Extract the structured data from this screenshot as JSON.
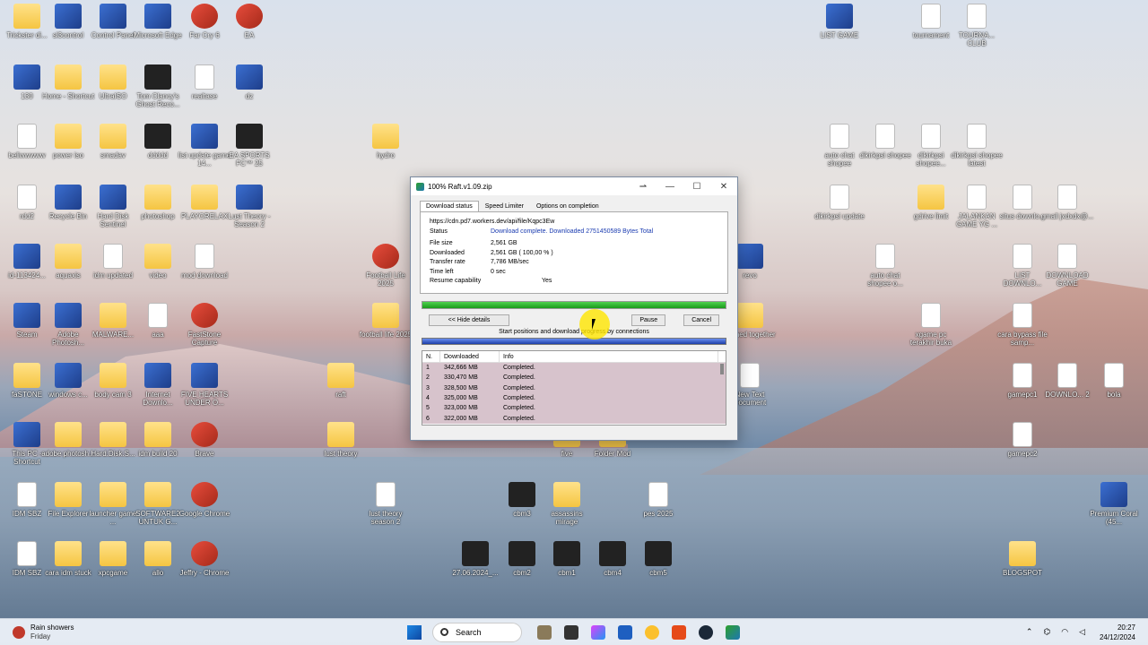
{
  "dialog": {
    "title": "100% Raft.v1.09.zip",
    "tabs": [
      "Download status",
      "Speed Limiter",
      "Options on completion"
    ],
    "url": "https://cdn.pd7.workers.dev/api/file/Kqpc3Ew",
    "status_label": "Status",
    "status_value": "Download complete. Downloaded 2751450589 Bytes Total",
    "file_size_label": "File size",
    "file_size": "2,561 GB",
    "downloaded_label": "Downloaded",
    "downloaded": "2,561 GB ( 100,00 % )",
    "transfer_rate_label": "Transfer rate",
    "transfer_rate": "7,786 MB/sec",
    "time_left_label": "Time left",
    "time_left": "0 sec",
    "resume_label": "Resume capability",
    "resume": "Yes",
    "progress": 1.0,
    "hide_details": "<< Hide details",
    "pause": "Pause",
    "cancel": "Cancel",
    "connections_caption": "Start positions and download progress by connections",
    "table_headers": [
      "N.",
      "Downloaded",
      "Info"
    ],
    "rows": [
      [
        "1",
        "342,666 MB",
        "Completed."
      ],
      [
        "2",
        "330,470 MB",
        "Completed."
      ],
      [
        "3",
        "328,500 MB",
        "Completed."
      ],
      [
        "4",
        "325,000 MB",
        "Completed."
      ],
      [
        "5",
        "323,000 MB",
        "Completed."
      ],
      [
        "6",
        "322,000 MB",
        "Completed."
      ]
    ]
  },
  "desktop_icons": [
    {
      "label": "Trickster di...",
      "kind": "folder"
    },
    {
      "label": "sl3control",
      "kind": "app"
    },
    {
      "label": "Control Panel",
      "kind": "app"
    },
    {
      "label": "Microsoft Edge",
      "kind": "app"
    },
    {
      "label": "Far Cry 6",
      "kind": "red"
    },
    {
      "label": "EA",
      "kind": "red"
    },
    {
      "label": "130",
      "kind": "app"
    },
    {
      "label": "Home - Shortcut",
      "kind": "folder"
    },
    {
      "label": "UltraISO",
      "kind": "folder"
    },
    {
      "label": "Tom Clancy's Ghost Reco...",
      "kind": "dark"
    },
    {
      "label": "realtase",
      "kind": "file"
    },
    {
      "label": "dz",
      "kind": "app"
    },
    {
      "label": "beliwwwww",
      "kind": "file"
    },
    {
      "label": "power iso",
      "kind": "folder"
    },
    {
      "label": "smadav",
      "kind": "folder"
    },
    {
      "label": "ddddd",
      "kind": "dark"
    },
    {
      "label": "list update game 14...",
      "kind": "app"
    },
    {
      "label": "EA SPORTS FC™ 25",
      "kind": "dark"
    },
    {
      "label": "hydro",
      "kind": "folder"
    },
    {
      "label": "rdd2",
      "kind": "file"
    },
    {
      "label": "Recycle Bin",
      "kind": "app"
    },
    {
      "label": "Hard Disk Sentinel",
      "kind": "app"
    },
    {
      "label": "photoshop",
      "kind": "folder"
    },
    {
      "label": "PLAYORELAX",
      "kind": "folder"
    },
    {
      "label": "Lust Theory - Season 2",
      "kind": "app"
    },
    {
      "label": "Football Life 2025",
      "kind": "red"
    },
    {
      "label": "id-113424...",
      "kind": "app"
    },
    {
      "label": "aquaxis",
      "kind": "folder"
    },
    {
      "label": "idm updated",
      "kind": "file"
    },
    {
      "label": "video",
      "kind": "folder"
    },
    {
      "label": "mod download",
      "kind": "file"
    },
    {
      "label": "Steam",
      "kind": "app"
    },
    {
      "label": "Adobe Photosh...",
      "kind": "app"
    },
    {
      "label": "MALWARE...",
      "kind": "folder"
    },
    {
      "label": "aaa",
      "kind": "file"
    },
    {
      "label": "FastStone Capture",
      "kind": "red"
    },
    {
      "label": "football life 2025",
      "kind": "folder"
    },
    {
      "label": "faSTONE",
      "kind": "folder"
    },
    {
      "label": "windows c...",
      "kind": "app"
    },
    {
      "label": "body cam 3",
      "kind": "folder"
    },
    {
      "label": "Internet Downlo...",
      "kind": "app"
    },
    {
      "label": "FIVE HEARTS UNDER O...",
      "kind": "app"
    },
    {
      "label": "raft",
      "kind": "folder"
    },
    {
      "label": "This PC - Shortcut",
      "kind": "app"
    },
    {
      "label": "adobe photosh...",
      "kind": "folder"
    },
    {
      "label": "Hard.Disk.S...",
      "kind": "folder"
    },
    {
      "label": "idm build 20",
      "kind": "folder"
    },
    {
      "label": "Brave",
      "kind": "red"
    },
    {
      "label": "lust theory",
      "kind": "folder"
    },
    {
      "label": "five",
      "kind": "folder"
    },
    {
      "label": "Folder Mod",
      "kind": "folder"
    },
    {
      "label": "IDM SBZ",
      "kind": "file"
    },
    {
      "label": "File Explorer",
      "kind": "folder"
    },
    {
      "label": "launcher game ...",
      "kind": "folder"
    },
    {
      "label": "SOFTWARE2 UNTUK G...",
      "kind": "folder"
    },
    {
      "label": "Google Chrome",
      "kind": "red"
    },
    {
      "label": "lust theory season 2",
      "kind": "file"
    },
    {
      "label": "cbm3",
      "kind": "dark"
    },
    {
      "label": "assassins mirage",
      "kind": "folder"
    },
    {
      "label": "pes 2025",
      "kind": "file"
    },
    {
      "label": "IDM SBZ",
      "kind": "file"
    },
    {
      "label": "cara idm stuck",
      "kind": "folder"
    },
    {
      "label": "xpcgame",
      "kind": "folder"
    },
    {
      "label": "allo",
      "kind": "folder"
    },
    {
      "label": "Jeffry - Chrome",
      "kind": "red"
    },
    {
      "label": "27.06.2024_...",
      "kind": "dark"
    },
    {
      "label": "cbm2",
      "kind": "dark"
    },
    {
      "label": "cbm1",
      "kind": "dark"
    },
    {
      "label": "cbm4",
      "kind": "dark"
    },
    {
      "label": "cbm5",
      "kind": "dark"
    },
    {
      "label": "LIST GAME",
      "kind": "app"
    },
    {
      "label": "tournament",
      "kind": "file"
    },
    {
      "label": "TOURNA... CLUB",
      "kind": "file"
    },
    {
      "label": "auto chat shopee",
      "kind": "file"
    },
    {
      "label": "dikirkpsi shopee",
      "kind": "file"
    },
    {
      "label": "dikirkpsi shopee...",
      "kind": "file"
    },
    {
      "label": "dikirkpsi shopee latest",
      "kind": "file"
    },
    {
      "label": "dikirkpsi update",
      "kind": "file"
    },
    {
      "label": "gdrive limit",
      "kind": "folder"
    },
    {
      "label": "JALANKAN GAME YG ...",
      "kind": "file"
    },
    {
      "label": "situs downlo...",
      "kind": "file"
    },
    {
      "label": "gmail jxdxdx@...",
      "kind": "file"
    },
    {
      "label": "revo",
      "kind": "app"
    },
    {
      "label": "auto chat shopee o...",
      "kind": "file"
    },
    {
      "label": "LIST DOWNLO...",
      "kind": "file"
    },
    {
      "label": "DOWNLOAD GAME",
      "kind": "file"
    },
    {
      "label": "stained together",
      "kind": "folder"
    },
    {
      "label": "xgame pc terakhir buka",
      "kind": "file"
    },
    {
      "label": "cara bypass file samp...",
      "kind": "file"
    },
    {
      "label": "New Text Document",
      "kind": "file"
    },
    {
      "label": "gamepc1",
      "kind": "file"
    },
    {
      "label": "DOWNLO... 2",
      "kind": "file"
    },
    {
      "label": "bola",
      "kind": "file"
    },
    {
      "label": "gamepc2",
      "kind": "file"
    },
    {
      "label": "Premium Coral (45...",
      "kind": "app"
    },
    {
      "label": "BLOGSPOT",
      "kind": "folder"
    }
  ],
  "taskbar": {
    "weather_title": "Rain showers",
    "weather_day": "Friday",
    "search_placeholder": "Search",
    "time": "20:27",
    "date": "24/12/2024"
  }
}
